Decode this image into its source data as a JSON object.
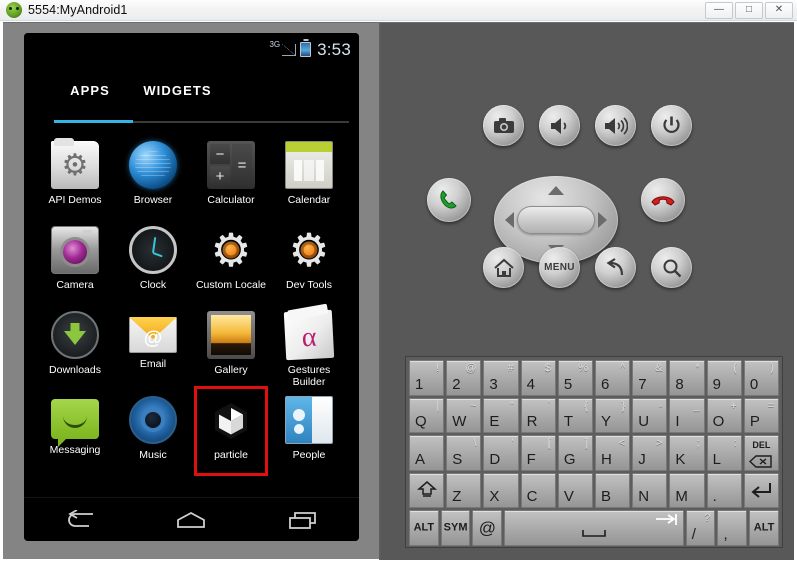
{
  "window": {
    "title": "5554:MyAndroid1",
    "app_icon": "android-head-icon",
    "ghost_text": "",
    "minimize": "—",
    "maximize": "□",
    "close": "✕"
  },
  "phone": {
    "status_bar": {
      "network": "3G",
      "signal_icon": "signal-triangle-icon",
      "battery_icon": "battery-icon",
      "clock": "3:53"
    },
    "tabs": [
      {
        "label": "APPS",
        "selected": true
      },
      {
        "label": "WIDGETS",
        "selected": false
      }
    ],
    "accent_color": "#33b5e5",
    "selection_color": "#e10f10",
    "apps": [
      {
        "label": "API Demos",
        "icon": "api-demos-icon",
        "selected": false
      },
      {
        "label": "Browser",
        "icon": "browser-icon",
        "selected": false
      },
      {
        "label": "Calculator",
        "icon": "calculator-icon",
        "selected": false
      },
      {
        "label": "Calendar",
        "icon": "calendar-icon",
        "selected": false
      },
      {
        "label": "Camera",
        "icon": "camera-icon",
        "selected": false
      },
      {
        "label": "Clock",
        "icon": "clock-icon",
        "selected": false
      },
      {
        "label": "Custom Locale",
        "icon": "custom-locale-icon",
        "selected": false
      },
      {
        "label": "Dev Tools",
        "icon": "dev-tools-icon",
        "selected": false
      },
      {
        "label": "Downloads",
        "icon": "downloads-icon",
        "selected": false
      },
      {
        "label": "Email",
        "icon": "email-icon",
        "selected": false
      },
      {
        "label": "Gallery",
        "icon": "gallery-icon",
        "selected": false
      },
      {
        "label": "Gestures Builder",
        "icon": "gestures-builder-icon",
        "selected": false
      },
      {
        "label": "Messaging",
        "icon": "messaging-icon",
        "selected": false
      },
      {
        "label": "Music",
        "icon": "music-icon",
        "selected": false
      },
      {
        "label": "particle",
        "icon": "unity-particle-icon",
        "selected": true
      },
      {
        "label": "People",
        "icon": "people-icon",
        "selected": false
      }
    ],
    "nav": [
      {
        "name": "back-icon"
      },
      {
        "name": "home-icon"
      },
      {
        "name": "recents-icon"
      }
    ]
  },
  "controls": {
    "top_row": [
      {
        "name": "camera-button",
        "icon": "camera-icon"
      },
      {
        "name": "volume-down-button",
        "icon": "volume-down-icon"
      },
      {
        "name": "volume-up-button",
        "icon": "volume-up-icon"
      },
      {
        "name": "power-button",
        "icon": "power-icon"
      }
    ],
    "call_button": {
      "name": "call-button",
      "icon": "phone-green-icon"
    },
    "endcall_button": {
      "name": "end-call-button",
      "icon": "phone-red-icon"
    },
    "dpad": {
      "up": "dpad-up-arrow",
      "down": "dpad-down-arrow",
      "left": "dpad-left-arrow",
      "right": "dpad-right-arrow",
      "center": "dpad-center-button"
    },
    "bottom_row": [
      {
        "name": "home-button",
        "icon": "home-icon",
        "label": ""
      },
      {
        "name": "menu-button",
        "icon": "",
        "label": "MENU"
      },
      {
        "name": "back-button",
        "icon": "back-arrow-icon",
        "label": ""
      },
      {
        "name": "search-button",
        "icon": "search-icon",
        "label": ""
      }
    ]
  },
  "keyboard": {
    "rows": [
      [
        {
          "main": "1",
          "sup": "!"
        },
        {
          "main": "2",
          "sup": "@"
        },
        {
          "main": "3",
          "sup": "#"
        },
        {
          "main": "4",
          "sup": "$"
        },
        {
          "main": "5",
          "sup": "%"
        },
        {
          "main": "6",
          "sup": "^"
        },
        {
          "main": "7",
          "sup": "&"
        },
        {
          "main": "8",
          "sup": "*"
        },
        {
          "main": "9",
          "sup": "("
        },
        {
          "main": "0",
          "sup": ")"
        }
      ],
      [
        {
          "main": "Q",
          "sup": "|"
        },
        {
          "main": "W",
          "sup": "~"
        },
        {
          "main": "E",
          "sup": "\""
        },
        {
          "main": "R",
          "sup": "`"
        },
        {
          "main": "T",
          "sup": "{"
        },
        {
          "main": "Y",
          "sup": "}"
        },
        {
          "main": "U",
          "sup": "-"
        },
        {
          "main": "I",
          "sup": "_"
        },
        {
          "main": "O",
          "sup": "+"
        },
        {
          "main": "P",
          "sup": "="
        }
      ],
      [
        {
          "main": "A",
          "sup": ""
        },
        {
          "main": "S",
          "sup": "\\"
        },
        {
          "main": "D",
          "sup": "'"
        },
        {
          "main": "F",
          "sup": "["
        },
        {
          "main": "G",
          "sup": "]"
        },
        {
          "main": "H",
          "sup": "<"
        },
        {
          "main": "J",
          "sup": ">"
        },
        {
          "main": "K",
          "sup": ";"
        },
        {
          "main": "L",
          "sup": ":"
        },
        {
          "main": "",
          "sup": "",
          "center": "DEL",
          "icon": "backspace-icon"
        }
      ],
      [
        {
          "main": "",
          "sup": "",
          "icon": "shift-icon"
        },
        {
          "main": "Z",
          "sup": ""
        },
        {
          "main": "X",
          "sup": ""
        },
        {
          "main": "C",
          "sup": ""
        },
        {
          "main": "V",
          "sup": ""
        },
        {
          "main": "B",
          "sup": ""
        },
        {
          "main": "N",
          "sup": ""
        },
        {
          "main": "M",
          "sup": ""
        },
        {
          "main": ".",
          "sup": ""
        },
        {
          "main": "",
          "sup": "",
          "icon": "enter-icon"
        }
      ],
      [
        {
          "center": "ALT"
        },
        {
          "center": "SYM"
        },
        {
          "center": "@",
          "sym": true
        },
        {
          "center": "",
          "icon": "space-tab-icon",
          "space": true
        },
        {
          "main": "/",
          "sup": "?"
        },
        {
          "main": ",",
          "sup": ""
        },
        {
          "center": "ALT"
        }
      ]
    ]
  }
}
